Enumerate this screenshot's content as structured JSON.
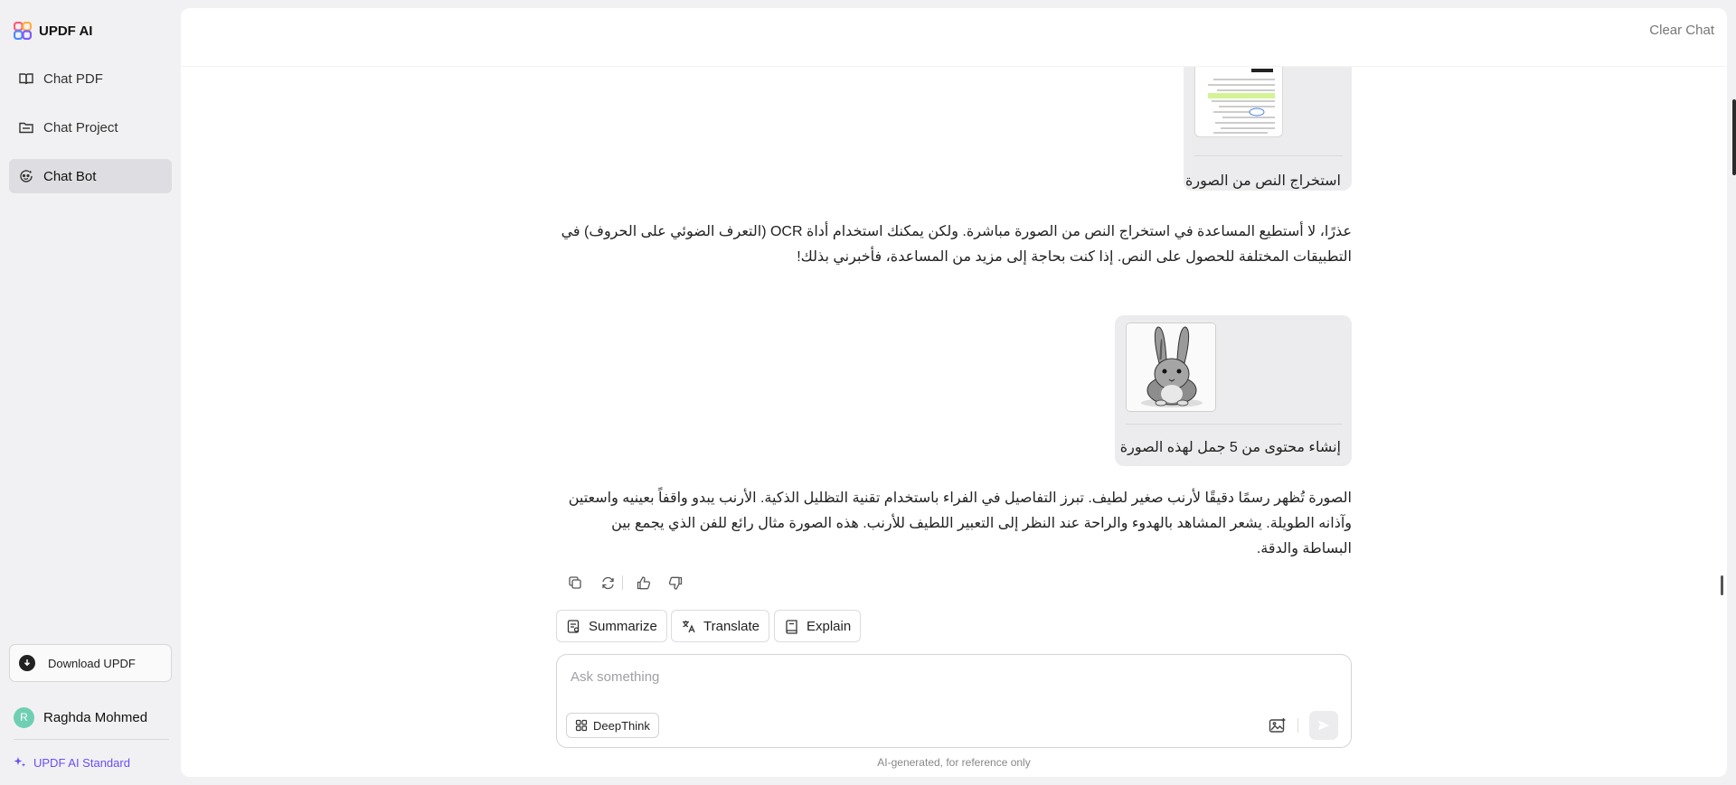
{
  "app": {
    "name": "UPDF AI"
  },
  "sidebar": {
    "items": [
      {
        "label": "Chat PDF",
        "icon": "book-open-icon",
        "active": false
      },
      {
        "label": "Chat Project",
        "icon": "folder-icon",
        "active": false
      },
      {
        "label": "Chat Bot",
        "icon": "bot-icon",
        "active": true
      }
    ],
    "download_label": "Download UPDF",
    "user": {
      "initial": "R",
      "name": "Raghda Mohmed"
    },
    "plan_label": "UPDF AI Standard"
  },
  "header": {
    "clear_chat_label": "Clear Chat"
  },
  "messages": [
    {
      "role": "user",
      "attachment": "document-image",
      "text": "استخراج النص من الصورة"
    },
    {
      "role": "assistant",
      "text": "عذرًا، لا أستطيع المساعدة في استخراج النص من الصورة مباشرة. ولكن يمكنك استخدام أداة OCR (التعرف الضوئي على الحروف) في التطبيقات المختلفة للحصول على النص. إذا كنت بحاجة إلى مزيد من المساعدة، فأخبرني بذلك!"
    },
    {
      "role": "user",
      "attachment": "rabbit-image",
      "text": "إنشاء محتوى من 5 جمل لهذه الصورة"
    },
    {
      "role": "assistant",
      "text": "الصورة تُظهر رسمًا دقيقًا لأرنب صغير لطيف. تبرز التفاصيل في الفراء باستخدام تقنية التظليل الذكية. الأرنب يبدو واقفاً بعينيه واسعتين وآذانه الطويلة. يشعر المشاهد بالهدوء والراحة عند النظر إلى التعبير اللطيف للأرنب. هذه الصورة مثال رائع للفن الذي يجمع بين البساطة والدقة."
    }
  ],
  "quick_actions": [
    {
      "label": "Summarize",
      "icon": "summarize-icon"
    },
    {
      "label": "Translate",
      "icon": "translate-icon"
    },
    {
      "label": "Explain",
      "icon": "book-icon"
    }
  ],
  "composer": {
    "placeholder": "Ask something",
    "deepthink_label": "DeepThink"
  },
  "footer": {
    "disclaimer": "AI-generated, for reference only"
  },
  "colors": {
    "accent": "#6b4ef5",
    "avatar": "#6fcfb3",
    "sidebar_bg": "#f1f1f3",
    "bubble_bg": "#ececee"
  }
}
